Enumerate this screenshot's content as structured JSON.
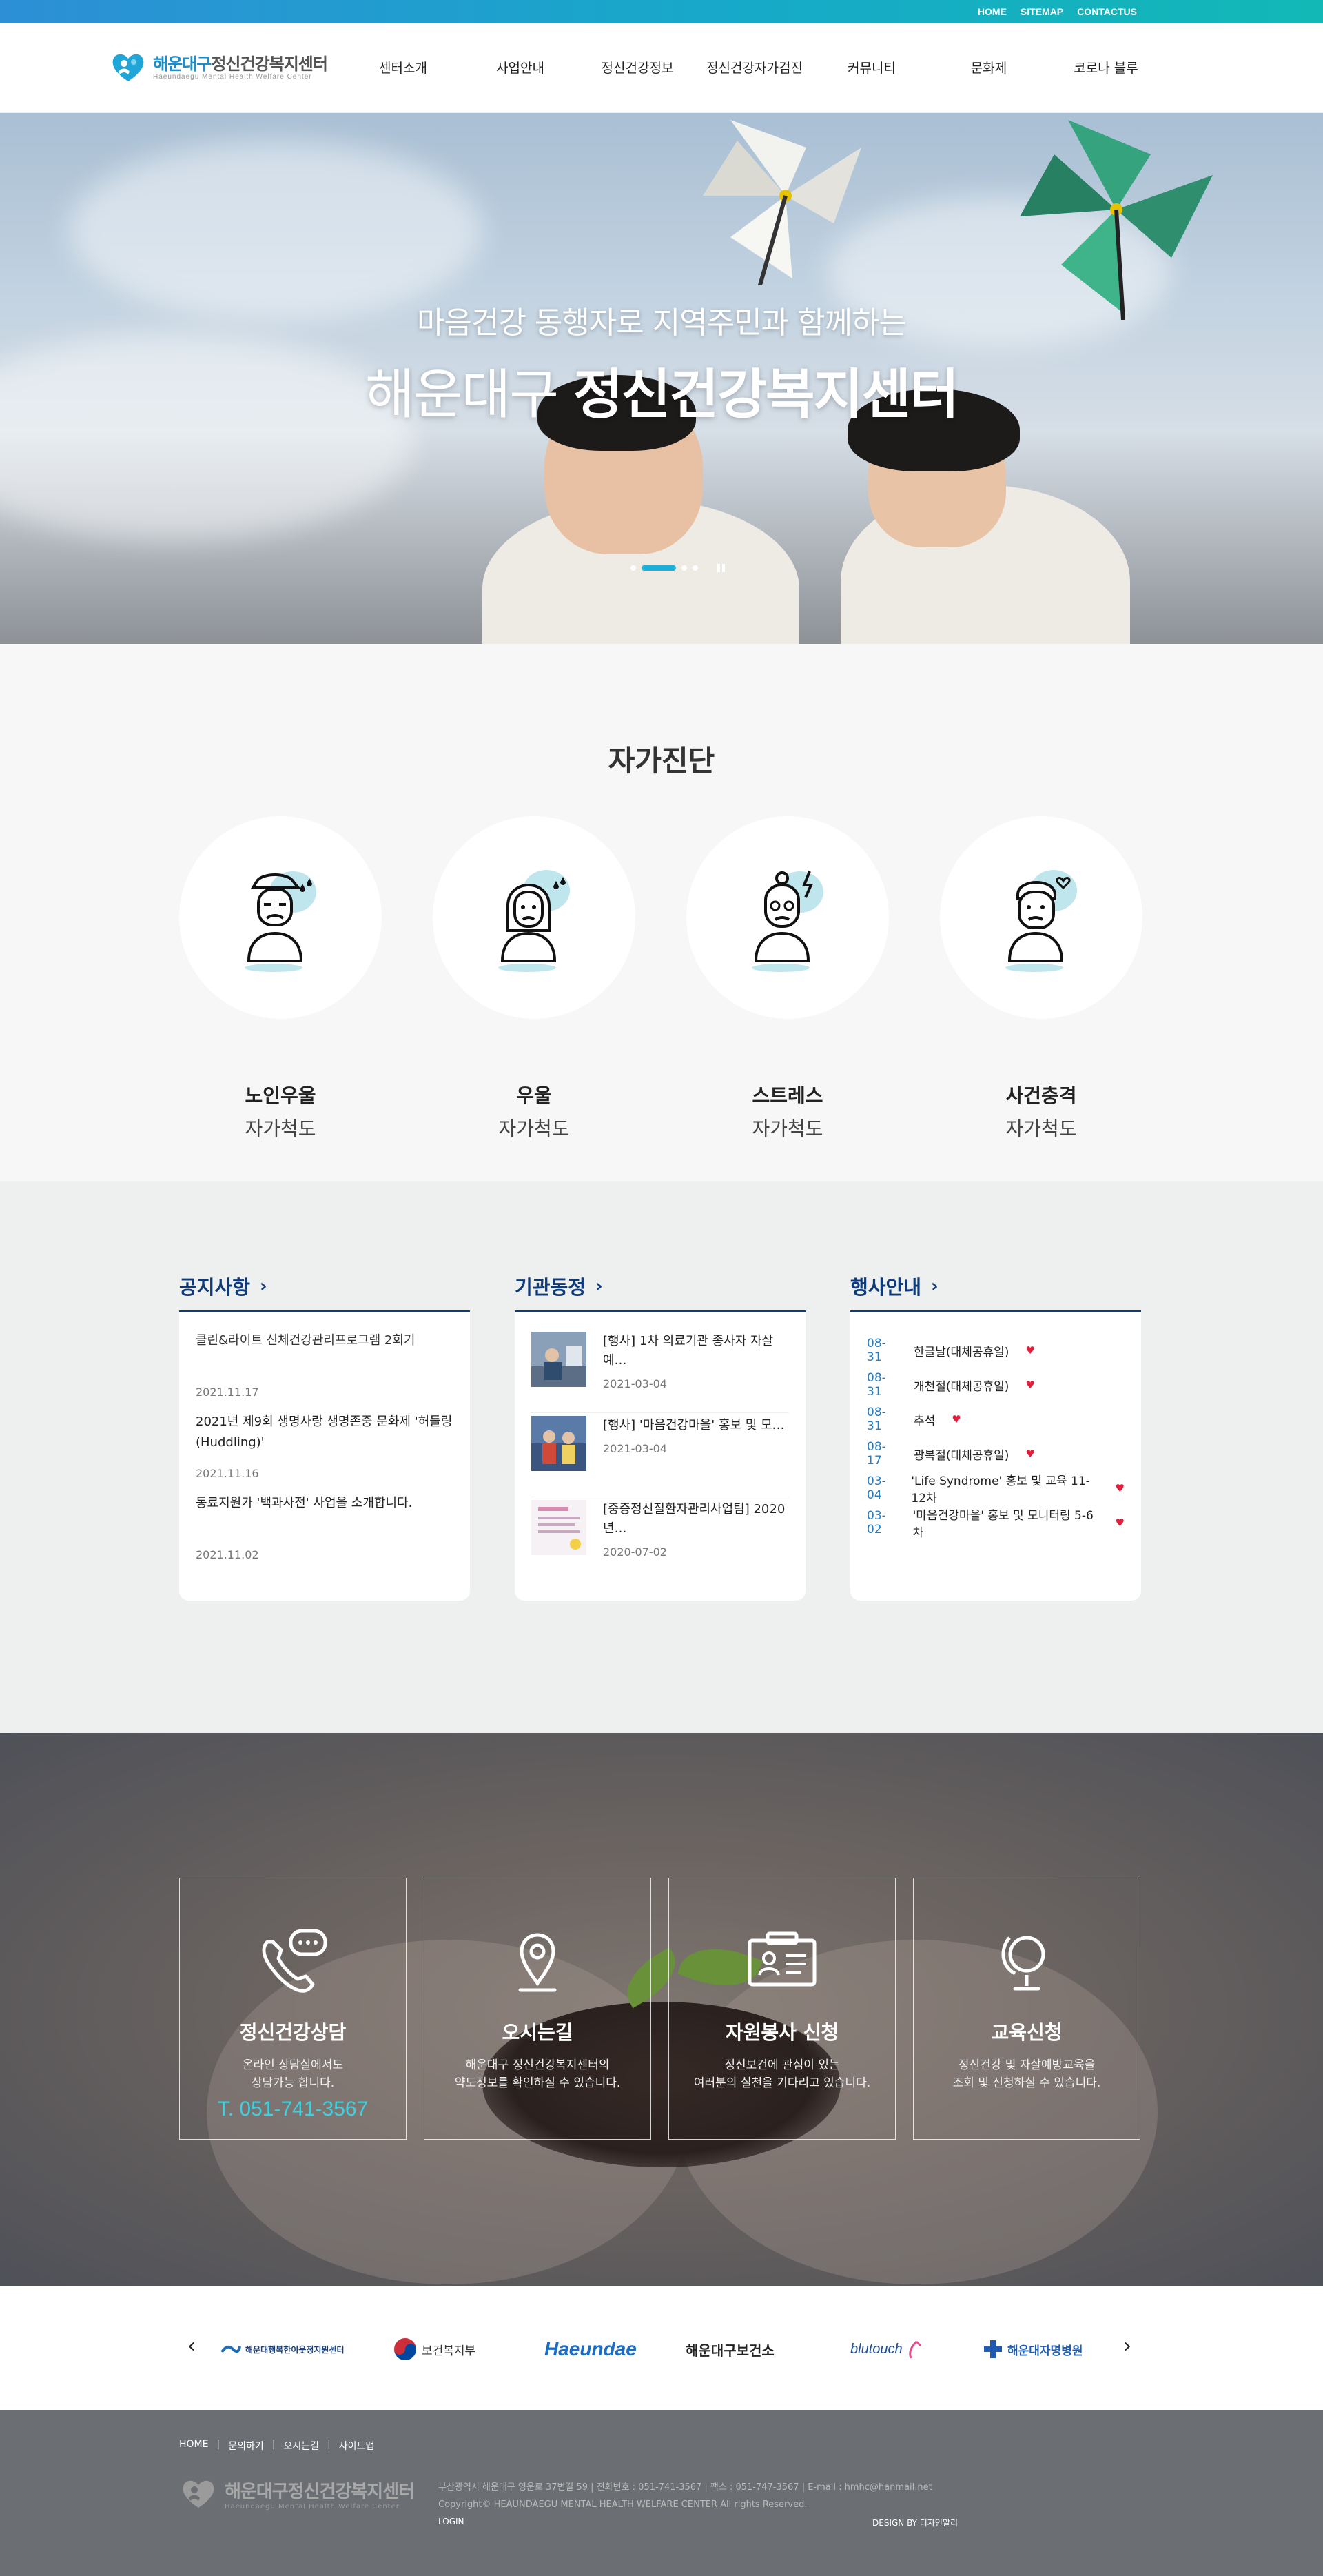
{
  "topbar": {
    "links": [
      "HOME",
      "SITEMAP",
      "CONTACTUS"
    ]
  },
  "header": {
    "logo_title_a": "해운대구",
    "logo_title_b": "정신건강복지센터",
    "logo_sub": "Haeundaegu Mental Health Welfare Center",
    "nav": [
      "센터소개",
      "사업안내",
      "정신건강정보",
      "정신건강자가검진",
      "커뮤니티",
      "문화제",
      "코로나 블루"
    ]
  },
  "hero": {
    "line1": "마음건강 동행자로 지역주민과 함께하는",
    "line2_thin": "해운대구",
    "line2_bold": "정신건강복지센터"
  },
  "selfcheck": {
    "title": "자가진단",
    "items": [
      {
        "name": "노인우울",
        "sub": "자가척도",
        "icon": "elderly-man-icon"
      },
      {
        "name": "우울",
        "sub": "자가척도",
        "icon": "sad-woman-icon"
      },
      {
        "name": "스트레스",
        "sub": "자가척도",
        "icon": "stressed-woman-icon"
      },
      {
        "name": "사건충격",
        "sub": "자가척도",
        "icon": "shocked-man-icon"
      }
    ]
  },
  "boards": {
    "notice": {
      "title": "공지사항",
      "items": [
        {
          "title": "클린&라이트 신체건강관리프로그램 2회기",
          "date": "2021.11.17"
        },
        {
          "title": "2021년 제9회 생명사랑 생명존중 문화제 '허들링(Huddling)'",
          "date": "2021.11.16"
        },
        {
          "title": "동료지원가 '백과사전' 사업을 소개합니다.",
          "date": "2021.11.02"
        }
      ]
    },
    "agency": {
      "title": "기관동정",
      "items": [
        {
          "title": "[행사] 1차 의료기관 종사자 자살예…",
          "date": "2021-03-04"
        },
        {
          "title": "[행사] '마음건강마을' 홍보 및 모…",
          "date": "2021-03-04"
        },
        {
          "title": "[중증정신질환자관리사업팀] 2020년…",
          "date": "2020-07-02"
        }
      ]
    },
    "events": {
      "title": "행사안내",
      "items": [
        {
          "date": "08-31",
          "title": "한글날(대체공휴일)"
        },
        {
          "date": "08-31",
          "title": "개천절(대체공휴일)"
        },
        {
          "date": "08-31",
          "title": "추석"
        },
        {
          "date": "08-17",
          "title": "광복절(대체공휴일)"
        },
        {
          "date": "03-04",
          "title": "'Life Syndrome' 홍보 및 교육 11-12차"
        },
        {
          "date": "03-02",
          "title": "'마음건강마을' 홍보 및 모니터링 5-6차"
        }
      ]
    }
  },
  "quick": [
    {
      "title": "정신건강상담",
      "desc1": "온라인 상담실에서도",
      "desc2": "상담가능 합니다.",
      "phone": "T. 051-741-3567",
      "icon": "phone-chat-icon"
    },
    {
      "title": "오시는길",
      "desc1": "해운대구 정신건강복지센터의",
      "desc2": "약도정보를 확인하실 수 있습니다.",
      "icon": "location-pin-icon"
    },
    {
      "title": "자원봉사 신청",
      "desc1": "정신보건에 관심이 있는",
      "desc2": "여러분의 실천을 기다리고 있습니다.",
      "icon": "id-card-icon"
    },
    {
      "title": "교육신청",
      "desc1": "정신건강 및 자살예방교육을",
      "desc2": "조회 및 신청하실 수 있습니다.",
      "icon": "globe-icon"
    }
  ],
  "partners": [
    {
      "name": "해운대행복한이웃정지원센터"
    },
    {
      "name": "보건복지부"
    },
    {
      "name": "Haeundae"
    },
    {
      "name": "해운대구보건소"
    },
    {
      "name": "blutouch"
    },
    {
      "name": "해운대자명병원"
    }
  ],
  "footer": {
    "links": [
      "HOME",
      "문의하기",
      "오시는길",
      "사이트맵"
    ],
    "logo_title": "해운대구정신건강복지센터",
    "logo_sub": "Haeundaegu Mental Health Welfare Center",
    "address": "부산광역시 해운대구 영운로 37번길 59  |  전화번호 : 051-741-3567  |  팩스 : 051-747-3567  |  E-mail : hmhc@hanmail.net",
    "copyright": "Copyright© HEAUNDAEGU MENTAL HEALTH WELFARE CENTER All rights Reserved.",
    "login": "LOGIN",
    "design": "DESIGN BY 디자인알리"
  },
  "colors": {
    "accent": "#1a8fcf",
    "navy": "#0e3a7a",
    "cyan": "#1bb0d9",
    "event_date": "#2a7cc0"
  }
}
